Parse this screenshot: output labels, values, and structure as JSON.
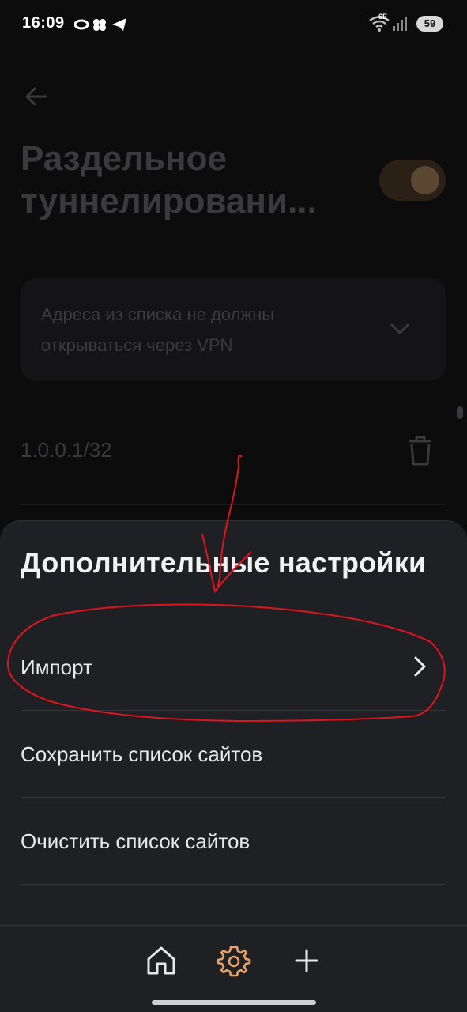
{
  "status_bar": {
    "time": "16:09",
    "network": "6E",
    "battery": "59"
  },
  "background_screen": {
    "title": "Раздельное туннелировани...",
    "toggle_state": "on",
    "mode_dropdown": {
      "selected": "Адреса из списка не должны открываться через VPN"
    },
    "entries": [
      "1.0.0.1/32"
    ]
  },
  "sheet": {
    "title": "Дополнительные настройки",
    "items": [
      {
        "label": "Импорт",
        "has_chevron": true
      },
      {
        "label": "Сохранить список сайтов",
        "has_chevron": false
      },
      {
        "label": "Очистить список сайтов",
        "has_chevron": false
      }
    ]
  },
  "bottom_nav": {
    "items": [
      {
        "icon": "home-icon"
      },
      {
        "icon": "gear-icon",
        "active": true
      },
      {
        "icon": "plus-icon"
      }
    ]
  },
  "colors": {
    "accent": "#e8a066",
    "annotation": "#e0141c",
    "sheet_bg": "#1f2024"
  }
}
